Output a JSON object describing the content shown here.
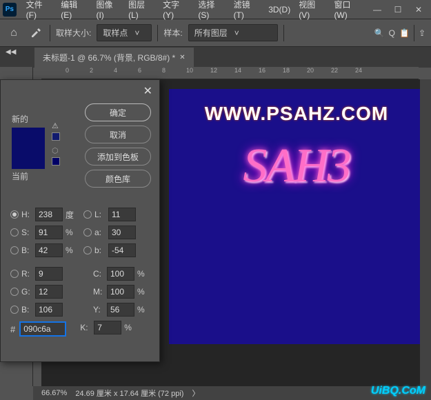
{
  "menu": {
    "items": [
      "文件(F)",
      "编辑(E)",
      "图像(I)",
      "图层(L)",
      "文字(Y)",
      "选择(S)",
      "滤镜(T)",
      "3D(D)",
      "视图(V)",
      "窗口(W)"
    ],
    "logo": "Ps"
  },
  "toolbar": {
    "sampleSizeLabel": "取样大小:",
    "sampleSizeValue": "取样点",
    "sampleLabel": "样本:",
    "sampleValue": "所有图层",
    "rightText": "🖥 Q 📋"
  },
  "tab": {
    "title": "未标题-1 @ 66.7% (背景, RGB/8#) *"
  },
  "ruler": {
    "marks": [
      "",
      "0",
      "2",
      "4",
      "6",
      "8",
      "10",
      "12",
      "14",
      "16",
      "18",
      "20",
      "22",
      "24"
    ]
  },
  "canvas": {
    "url": "WWW.PSAHZ.COM",
    "neon": "SAH3"
  },
  "colorPicker": {
    "newLabel": "新的",
    "currentLabel": "当前",
    "buttons": {
      "ok": "确定",
      "cancel": "取消",
      "addSwatch": "添加到色板",
      "colorLib": "颜色库"
    },
    "fields": {
      "H": {
        "label": "H:",
        "value": "238",
        "unit": "度"
      },
      "S": {
        "label": "S:",
        "value": "91",
        "unit": "%"
      },
      "Bv": {
        "label": "B:",
        "value": "42",
        "unit": "%"
      },
      "L": {
        "label": "L:",
        "value": "11"
      },
      "a": {
        "label": "a:",
        "value": "30"
      },
      "b": {
        "label": "b:",
        "value": "-54"
      },
      "R": {
        "label": "R:",
        "value": "9"
      },
      "G": {
        "label": "G:",
        "value": "12"
      },
      "Bc": {
        "label": "B:",
        "value": "106"
      },
      "C": {
        "label": "C:",
        "value": "100",
        "unit": "%"
      },
      "M": {
        "label": "M:",
        "value": "100",
        "unit": "%"
      },
      "Y": {
        "label": "Y:",
        "value": "56",
        "unit": "%"
      },
      "K": {
        "label": "K:",
        "value": "7",
        "unit": "%"
      }
    },
    "hexLabel": "#",
    "hexValue": "090c6a"
  },
  "status": {
    "zoom": "66.67%",
    "dims": "24.69 厘米 x 17.64 厘米 (72 ppi)"
  },
  "watermark": "UiBQ.CoM"
}
